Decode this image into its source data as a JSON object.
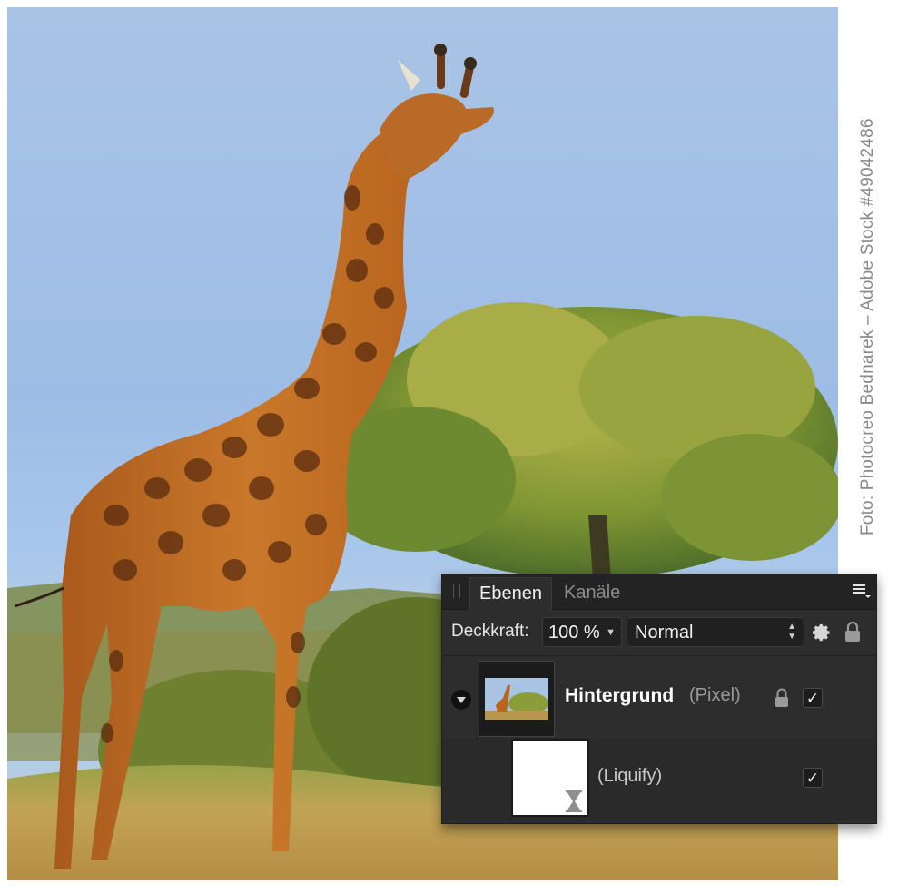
{
  "photo": {
    "subject": "giraffe-with-acacia-tree",
    "credit": "Foto: Photocreo Bednarek – Adobe Stock #49042486"
  },
  "panel": {
    "tabs": [
      {
        "label": "Ebenen",
        "active": true
      },
      {
        "label": "Kanäle",
        "active": false
      }
    ],
    "menu_icon": "panel-menu-icon",
    "opacity_label": "Deckkraft:",
    "opacity_value": "100 %",
    "blend_mode": "Normal",
    "settings_icon": "gear-icon",
    "lock_icon": "lock-icon",
    "layers": [
      {
        "name": "Hintergrund",
        "type": "(Pixel)",
        "locked": true,
        "visible": true,
        "expanded": true
      },
      {
        "name": "(Liquify)",
        "visible": true,
        "kind": "live-filter"
      }
    ]
  },
  "colors": {
    "panel_bg": "#2d2d2d",
    "tab_bar_bg": "#232323",
    "sky": "#a9c3e5",
    "giraffe": "#b8651e",
    "foliage": "#8c9e37"
  }
}
